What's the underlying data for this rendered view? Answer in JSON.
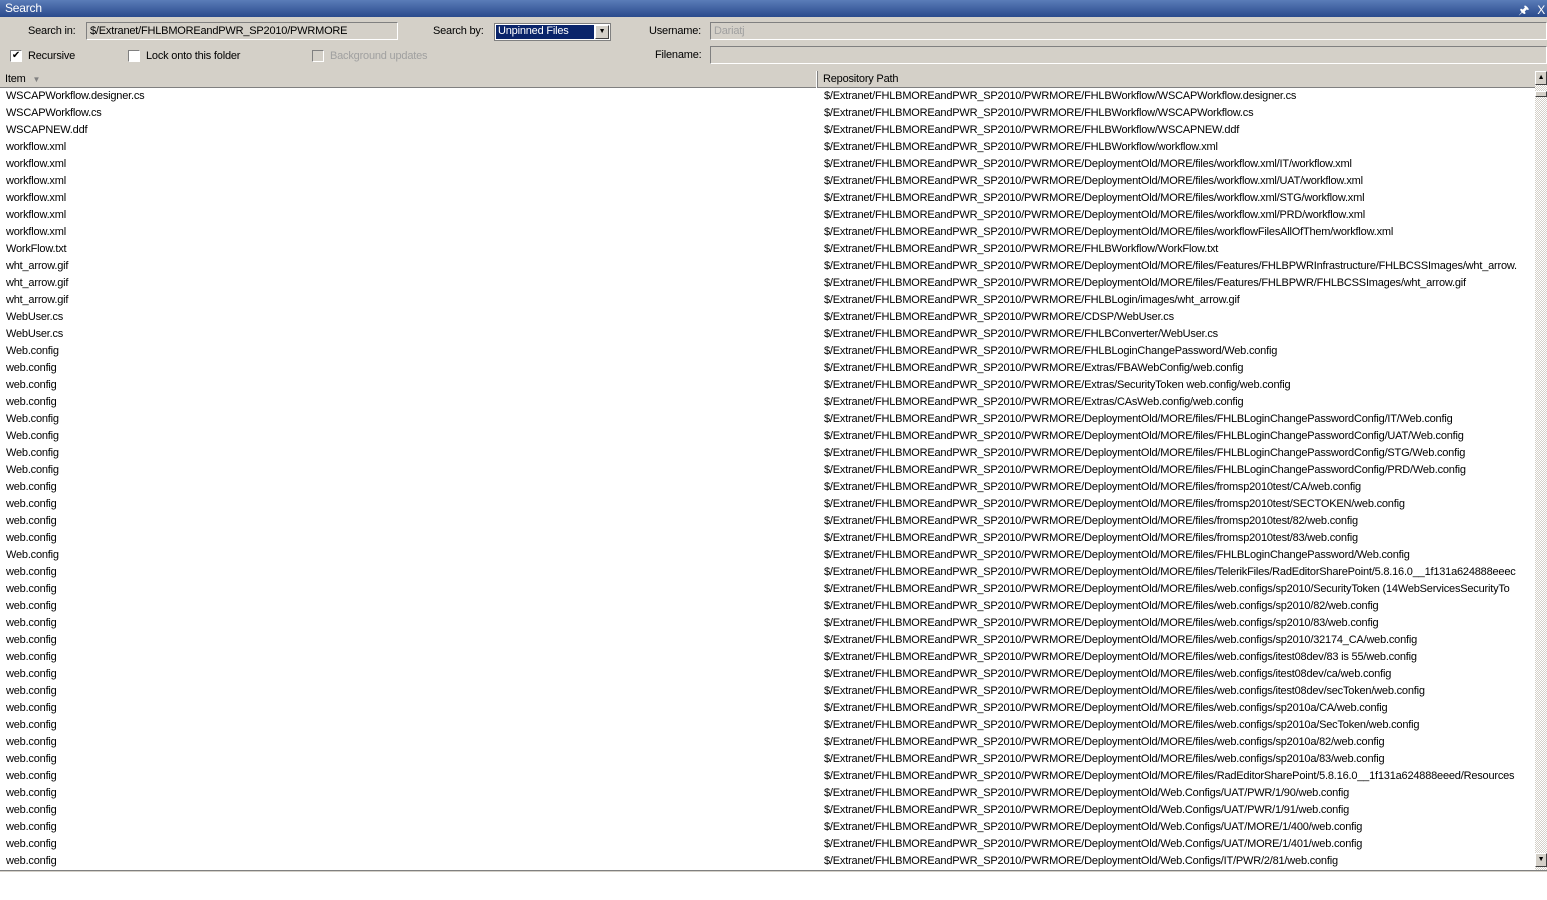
{
  "window": {
    "title": "Search",
    "pin_icon": "pin-icon",
    "close_icon": "close-icon",
    "pin": "%a",
    "close": "X"
  },
  "form": {
    "search_in_label": "Search in:",
    "search_in_value": "$/Extranet/FHLBMOREandPWR_SP2010/PWRMORE",
    "search_by_label": "Search by:",
    "search_by_value": "Unpinned Files",
    "username_label": "Username:",
    "username_value": "Dariatj",
    "filename_label": "Filename:",
    "filename_value": "",
    "recursive_label": "Recursive",
    "recursive_checked": true,
    "lock_label": "Lock onto this folder",
    "lock_checked": false,
    "background_label": "Background updates",
    "background_checked": false,
    "background_disabled": true
  },
  "table": {
    "columns": [
      "Item",
      "Repository Path"
    ],
    "sort_column": "Item",
    "rows": [
      [
        "WSCAPWorkflow.designer.cs",
        "$/Extranet/FHLBMOREandPWR_SP2010/PWRMORE/FHLBWorkflow/WSCAPWorkflow.designer.cs"
      ],
      [
        "WSCAPWorkflow.cs",
        "$/Extranet/FHLBMOREandPWR_SP2010/PWRMORE/FHLBWorkflow/WSCAPWorkflow.cs"
      ],
      [
        "WSCAPNEW.ddf",
        "$/Extranet/FHLBMOREandPWR_SP2010/PWRMORE/FHLBWorkflow/WSCAPNEW.ddf"
      ],
      [
        "workflow.xml",
        "$/Extranet/FHLBMOREandPWR_SP2010/PWRMORE/FHLBWorkflow/workflow.xml"
      ],
      [
        "workflow.xml",
        "$/Extranet/FHLBMOREandPWR_SP2010/PWRMORE/DeploymentOld/MORE/files/workflow.xml/IT/workflow.xml"
      ],
      [
        "workflow.xml",
        "$/Extranet/FHLBMOREandPWR_SP2010/PWRMORE/DeploymentOld/MORE/files/workflow.xml/UAT/workflow.xml"
      ],
      [
        "workflow.xml",
        "$/Extranet/FHLBMOREandPWR_SP2010/PWRMORE/DeploymentOld/MORE/files/workflow.xml/STG/workflow.xml"
      ],
      [
        "workflow.xml",
        "$/Extranet/FHLBMOREandPWR_SP2010/PWRMORE/DeploymentOld/MORE/files/workflow.xml/PRD/workflow.xml"
      ],
      [
        "workflow.xml",
        "$/Extranet/FHLBMOREandPWR_SP2010/PWRMORE/DeploymentOld/MORE/files/workflowFilesAllOfThem/workflow.xml"
      ],
      [
        "WorkFlow.txt",
        "$/Extranet/FHLBMOREandPWR_SP2010/PWRMORE/FHLBWorkflow/WorkFlow.txt"
      ],
      [
        "wht_arrow.gif",
        "$/Extranet/FHLBMOREandPWR_SP2010/PWRMORE/DeploymentOld/MORE/files/Features/FHLBPWRInfrastructure/FHLBCSSImages/wht_arrow."
      ],
      [
        "wht_arrow.gif",
        "$/Extranet/FHLBMOREandPWR_SP2010/PWRMORE/DeploymentOld/MORE/files/Features/FHLBPWR/FHLBCSSImages/wht_arrow.gif"
      ],
      [
        "wht_arrow.gif",
        "$/Extranet/FHLBMOREandPWR_SP2010/PWRMORE/FHLBLogin/images/wht_arrow.gif"
      ],
      [
        "WebUser.cs",
        "$/Extranet/FHLBMOREandPWR_SP2010/PWRMORE/CDSP/WebUser.cs"
      ],
      [
        "WebUser.cs",
        "$/Extranet/FHLBMOREandPWR_SP2010/PWRMORE/FHLBConverter/WebUser.cs"
      ],
      [
        "Web.config",
        "$/Extranet/FHLBMOREandPWR_SP2010/PWRMORE/FHLBLoginChangePassword/Web.config"
      ],
      [
        "web.config",
        "$/Extranet/FHLBMOREandPWR_SP2010/PWRMORE/Extras/FBAWebConfig/web.config"
      ],
      [
        "web.config",
        "$/Extranet/FHLBMOREandPWR_SP2010/PWRMORE/Extras/SecurityToken web.config/web.config"
      ],
      [
        "web.config",
        "$/Extranet/FHLBMOREandPWR_SP2010/PWRMORE/Extras/CAsWeb.config/web.config"
      ],
      [
        "Web.config",
        "$/Extranet/FHLBMOREandPWR_SP2010/PWRMORE/DeploymentOld/MORE/files/FHLBLoginChangePasswordConfig/IT/Web.config"
      ],
      [
        "Web.config",
        "$/Extranet/FHLBMOREandPWR_SP2010/PWRMORE/DeploymentOld/MORE/files/FHLBLoginChangePasswordConfig/UAT/Web.config"
      ],
      [
        "Web.config",
        "$/Extranet/FHLBMOREandPWR_SP2010/PWRMORE/DeploymentOld/MORE/files/FHLBLoginChangePasswordConfig/STG/Web.config"
      ],
      [
        "Web.config",
        "$/Extranet/FHLBMOREandPWR_SP2010/PWRMORE/DeploymentOld/MORE/files/FHLBLoginChangePasswordConfig/PRD/Web.config"
      ],
      [
        "web.config",
        "$/Extranet/FHLBMOREandPWR_SP2010/PWRMORE/DeploymentOld/MORE/files/fromsp2010test/CA/web.config"
      ],
      [
        "web.config",
        "$/Extranet/FHLBMOREandPWR_SP2010/PWRMORE/DeploymentOld/MORE/files/fromsp2010test/SECTOKEN/web.config"
      ],
      [
        "web.config",
        "$/Extranet/FHLBMOREandPWR_SP2010/PWRMORE/DeploymentOld/MORE/files/fromsp2010test/82/web.config"
      ],
      [
        "web.config",
        "$/Extranet/FHLBMOREandPWR_SP2010/PWRMORE/DeploymentOld/MORE/files/fromsp2010test/83/web.config"
      ],
      [
        "Web.config",
        "$/Extranet/FHLBMOREandPWR_SP2010/PWRMORE/DeploymentOld/MORE/files/FHLBLoginChangePassword/Web.config"
      ],
      [
        "web.config",
        "$/Extranet/FHLBMOREandPWR_SP2010/PWRMORE/DeploymentOld/MORE/files/TelerikFiles/RadEditorSharePoint/5.8.16.0__1f131a624888eeec"
      ],
      [
        "web.config",
        "$/Extranet/FHLBMOREandPWR_SP2010/PWRMORE/DeploymentOld/MORE/files/web.configs/sp2010/SecurityToken (14WebServicesSecurityTo"
      ],
      [
        "web.config",
        "$/Extranet/FHLBMOREandPWR_SP2010/PWRMORE/DeploymentOld/MORE/files/web.configs/sp2010/82/web.config"
      ],
      [
        "web.config",
        "$/Extranet/FHLBMOREandPWR_SP2010/PWRMORE/DeploymentOld/MORE/files/web.configs/sp2010/83/web.config"
      ],
      [
        "web.config",
        "$/Extranet/FHLBMOREandPWR_SP2010/PWRMORE/DeploymentOld/MORE/files/web.configs/sp2010/32174_CA/web.config"
      ],
      [
        "web.config",
        "$/Extranet/FHLBMOREandPWR_SP2010/PWRMORE/DeploymentOld/MORE/files/web.configs/itest08dev/83 is 55/web.config"
      ],
      [
        "web.config",
        "$/Extranet/FHLBMOREandPWR_SP2010/PWRMORE/DeploymentOld/MORE/files/web.configs/itest08dev/ca/web.config"
      ],
      [
        "web.config",
        "$/Extranet/FHLBMOREandPWR_SP2010/PWRMORE/DeploymentOld/MORE/files/web.configs/itest08dev/secToken/web.config"
      ],
      [
        "web.config",
        "$/Extranet/FHLBMOREandPWR_SP2010/PWRMORE/DeploymentOld/MORE/files/web.configs/sp2010a/CA/web.config"
      ],
      [
        "web.config",
        "$/Extranet/FHLBMOREandPWR_SP2010/PWRMORE/DeploymentOld/MORE/files/web.configs/sp2010a/SecToken/web.config"
      ],
      [
        "web.config",
        "$/Extranet/FHLBMOREandPWR_SP2010/PWRMORE/DeploymentOld/MORE/files/web.configs/sp2010a/82/web.config"
      ],
      [
        "web.config",
        "$/Extranet/FHLBMOREandPWR_SP2010/PWRMORE/DeploymentOld/MORE/files/web.configs/sp2010a/83/web.config"
      ],
      [
        "web.config",
        "$/Extranet/FHLBMOREandPWR_SP2010/PWRMORE/DeploymentOld/MORE/files/RadEditorSharePoint/5.8.16.0__1f131a624888eeed/Resources"
      ],
      [
        "web.config",
        "$/Extranet/FHLBMOREandPWR_SP2010/PWRMORE/DeploymentOld/Web.Configs/UAT/PWR/1/90/web.config"
      ],
      [
        "web.config",
        "$/Extranet/FHLBMOREandPWR_SP2010/PWRMORE/DeploymentOld/Web.Configs/UAT/PWR/1/91/web.config"
      ],
      [
        "web.config",
        "$/Extranet/FHLBMOREandPWR_SP2010/PWRMORE/DeploymentOld/Web.Configs/UAT/MORE/1/400/web.config"
      ],
      [
        "web.config",
        "$/Extranet/FHLBMOREandPWR_SP2010/PWRMORE/DeploymentOld/Web.Configs/UAT/MORE/1/401/web.config"
      ],
      [
        "web.config",
        "$/Extranet/FHLBMOREandPWR_SP2010/PWRMORE/DeploymentOld/Web.Configs/IT/PWR/2/81/web.config"
      ]
    ]
  }
}
